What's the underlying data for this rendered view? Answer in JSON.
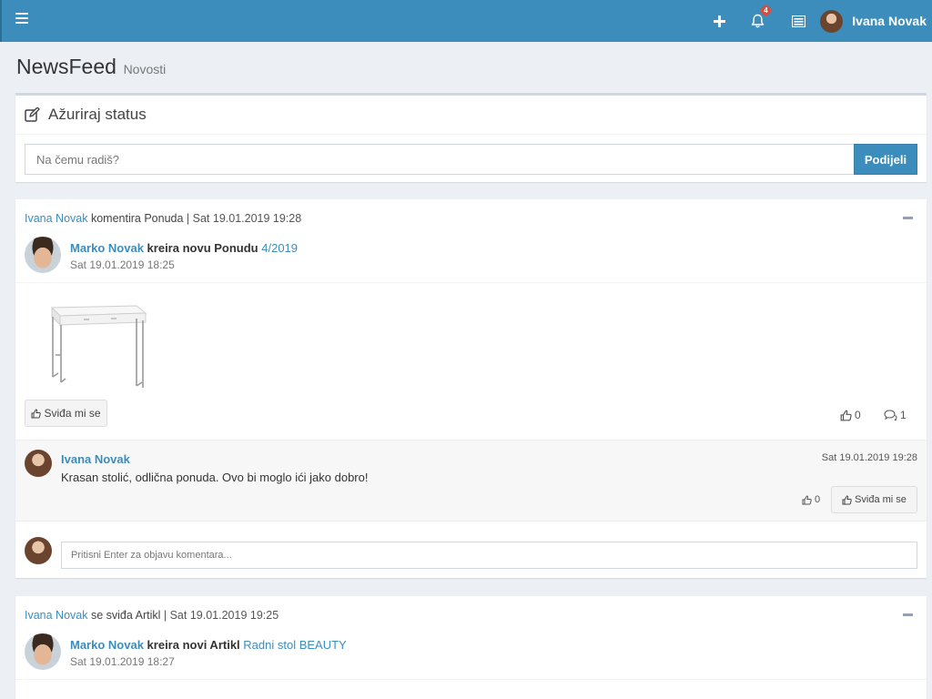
{
  "header": {
    "user_name": "Ivana Novak",
    "notification_count": "4"
  },
  "page": {
    "title": "NewsFeed",
    "subtitle": "Novosti"
  },
  "status": {
    "title": "Ažuriraj status",
    "placeholder": "Na čemu radiš?",
    "share_label": "Podijeli"
  },
  "posts": [
    {
      "activity_user": "Ivana Novak",
      "activity_action": "komentira Ponuda",
      "activity_date": "| Sat 19.01.2019 19:28",
      "author": "Marko Novak",
      "action": "kreira novu Ponudu",
      "target": "4/2019",
      "date": "Sat 19.01.2019 18:25",
      "like_label": "Sviđa mi se",
      "likes": "0",
      "comments_count": "1",
      "comments": [
        {
          "author": "Ivana Novak",
          "date": "Sat 19.01.2019 19:28",
          "text": "Krasan stolić, odlična ponuda. Ovo bi moglo ići jako dobro!",
          "likes": "0",
          "like_label": "Sviđa mi se"
        }
      ],
      "comment_placeholder": "Pritisni Enter za objavu komentara..."
    },
    {
      "activity_user": "Ivana Novak",
      "activity_action": "se sviđa Artikl",
      "activity_date": "| Sat 19.01.2019 19:25",
      "author": "Marko Novak",
      "action": "kreira novi Artikl",
      "target": "Radni stol BEAUTY",
      "date": "Sat 19.01.2019 18:27"
    }
  ],
  "colors": {
    "primary": "#3c8dbc",
    "background": "#ecf0f5",
    "badge": "#dd4b39"
  },
  "icons": [
    "menu-icon",
    "plus-icon",
    "bell-icon",
    "tasks-icon",
    "edit-icon",
    "thumbs-up-icon",
    "comments-icon",
    "minus-icon"
  ]
}
